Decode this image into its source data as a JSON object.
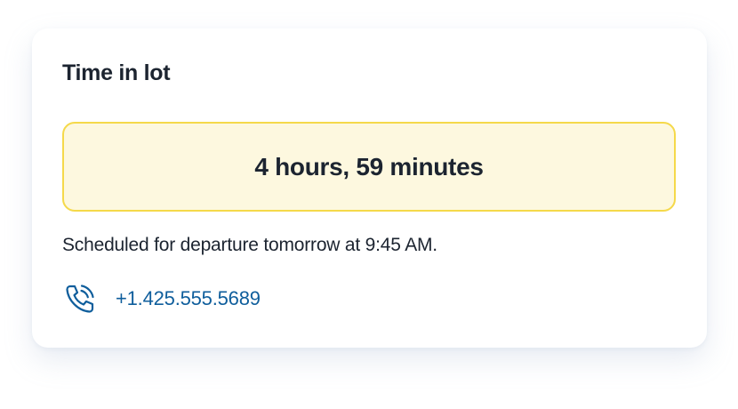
{
  "card": {
    "title": "Time in lot",
    "duration": "4 hours, 59 minutes",
    "departure_note": "Scheduled for departure tomorrow at 9:45 AM.",
    "phone": {
      "number": "+1.425.555.5689",
      "icon": "phone-call-icon"
    }
  },
  "colors": {
    "highlight_bg": "#fdf8df",
    "highlight_border": "#f5d94a",
    "link": "#0f5e9c",
    "text": "#1c2430"
  }
}
